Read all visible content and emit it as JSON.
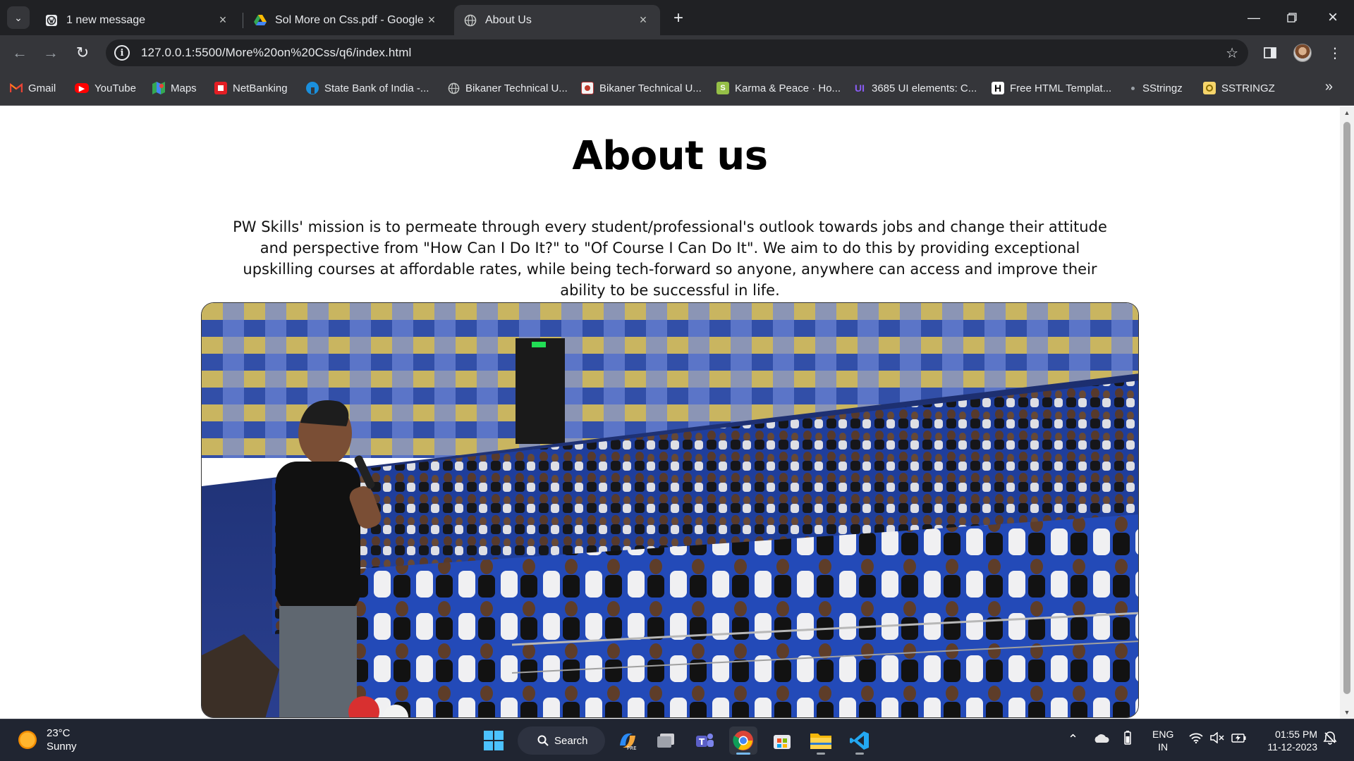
{
  "browser": {
    "tabs": [
      {
        "title": "1 new message",
        "favicon": "wordpress-icon",
        "active": false
      },
      {
        "title": "Sol More on Css.pdf - Google D",
        "favicon": "google-drive-icon",
        "active": false
      },
      {
        "title": "About Us",
        "favicon": "globe-icon",
        "active": true
      }
    ],
    "url": "127.0.0.1:5500/More%20on%20Css/q6/index.html",
    "bookmarks": [
      {
        "label": "Gmail",
        "icon": "gmail-icon"
      },
      {
        "label": "YouTube",
        "icon": "youtube-icon"
      },
      {
        "label": "Maps",
        "icon": "maps-icon"
      },
      {
        "label": "NetBanking",
        "icon": "hdfc-icon"
      },
      {
        "label": "State Bank of India -...",
        "icon": "sbi-icon"
      },
      {
        "label": "Bikaner Technical U...",
        "icon": "globe-icon"
      },
      {
        "label": "Bikaner Technical U...",
        "icon": "university-crest-icon"
      },
      {
        "label": "Karma & Peace · Ho...",
        "icon": "shopify-icon"
      },
      {
        "label": "3685 UI elements: C...",
        "icon": "uiverse-icon"
      },
      {
        "label": "Free HTML Templat...",
        "icon": "h-logo-icon"
      },
      {
        "label": "SStringz",
        "icon": "dot-icon"
      },
      {
        "label": "SSTRINGZ",
        "icon": "sstringz-icon"
      }
    ]
  },
  "page": {
    "title": "About us",
    "paragraph": "PW Skills' mission is to permeate through every student/professional's outlook towards jobs and change their attitude and perspective from \"How Can I Do It?\" to \"Of Course I Can Do It\". We aim to do this by providing exceptional upskilling courses at affordable rates, while being tech-forward so anyone, anywhere can access and improve their ability to be successful in life.",
    "hero_image": "auditorium-audience-photo"
  },
  "taskbar": {
    "weather_temp": "23°C",
    "weather_desc": "Sunny",
    "search_label": "Search",
    "lang_line1": "ENG",
    "lang_line2": "IN",
    "time": "01:55 PM",
    "date": "11-12-2023"
  },
  "colors": {
    "chrome_dark": "#202124",
    "chrome_toolbar": "#35363a",
    "taskbar": "#202531",
    "seat_blue": "#1f4fbf"
  }
}
